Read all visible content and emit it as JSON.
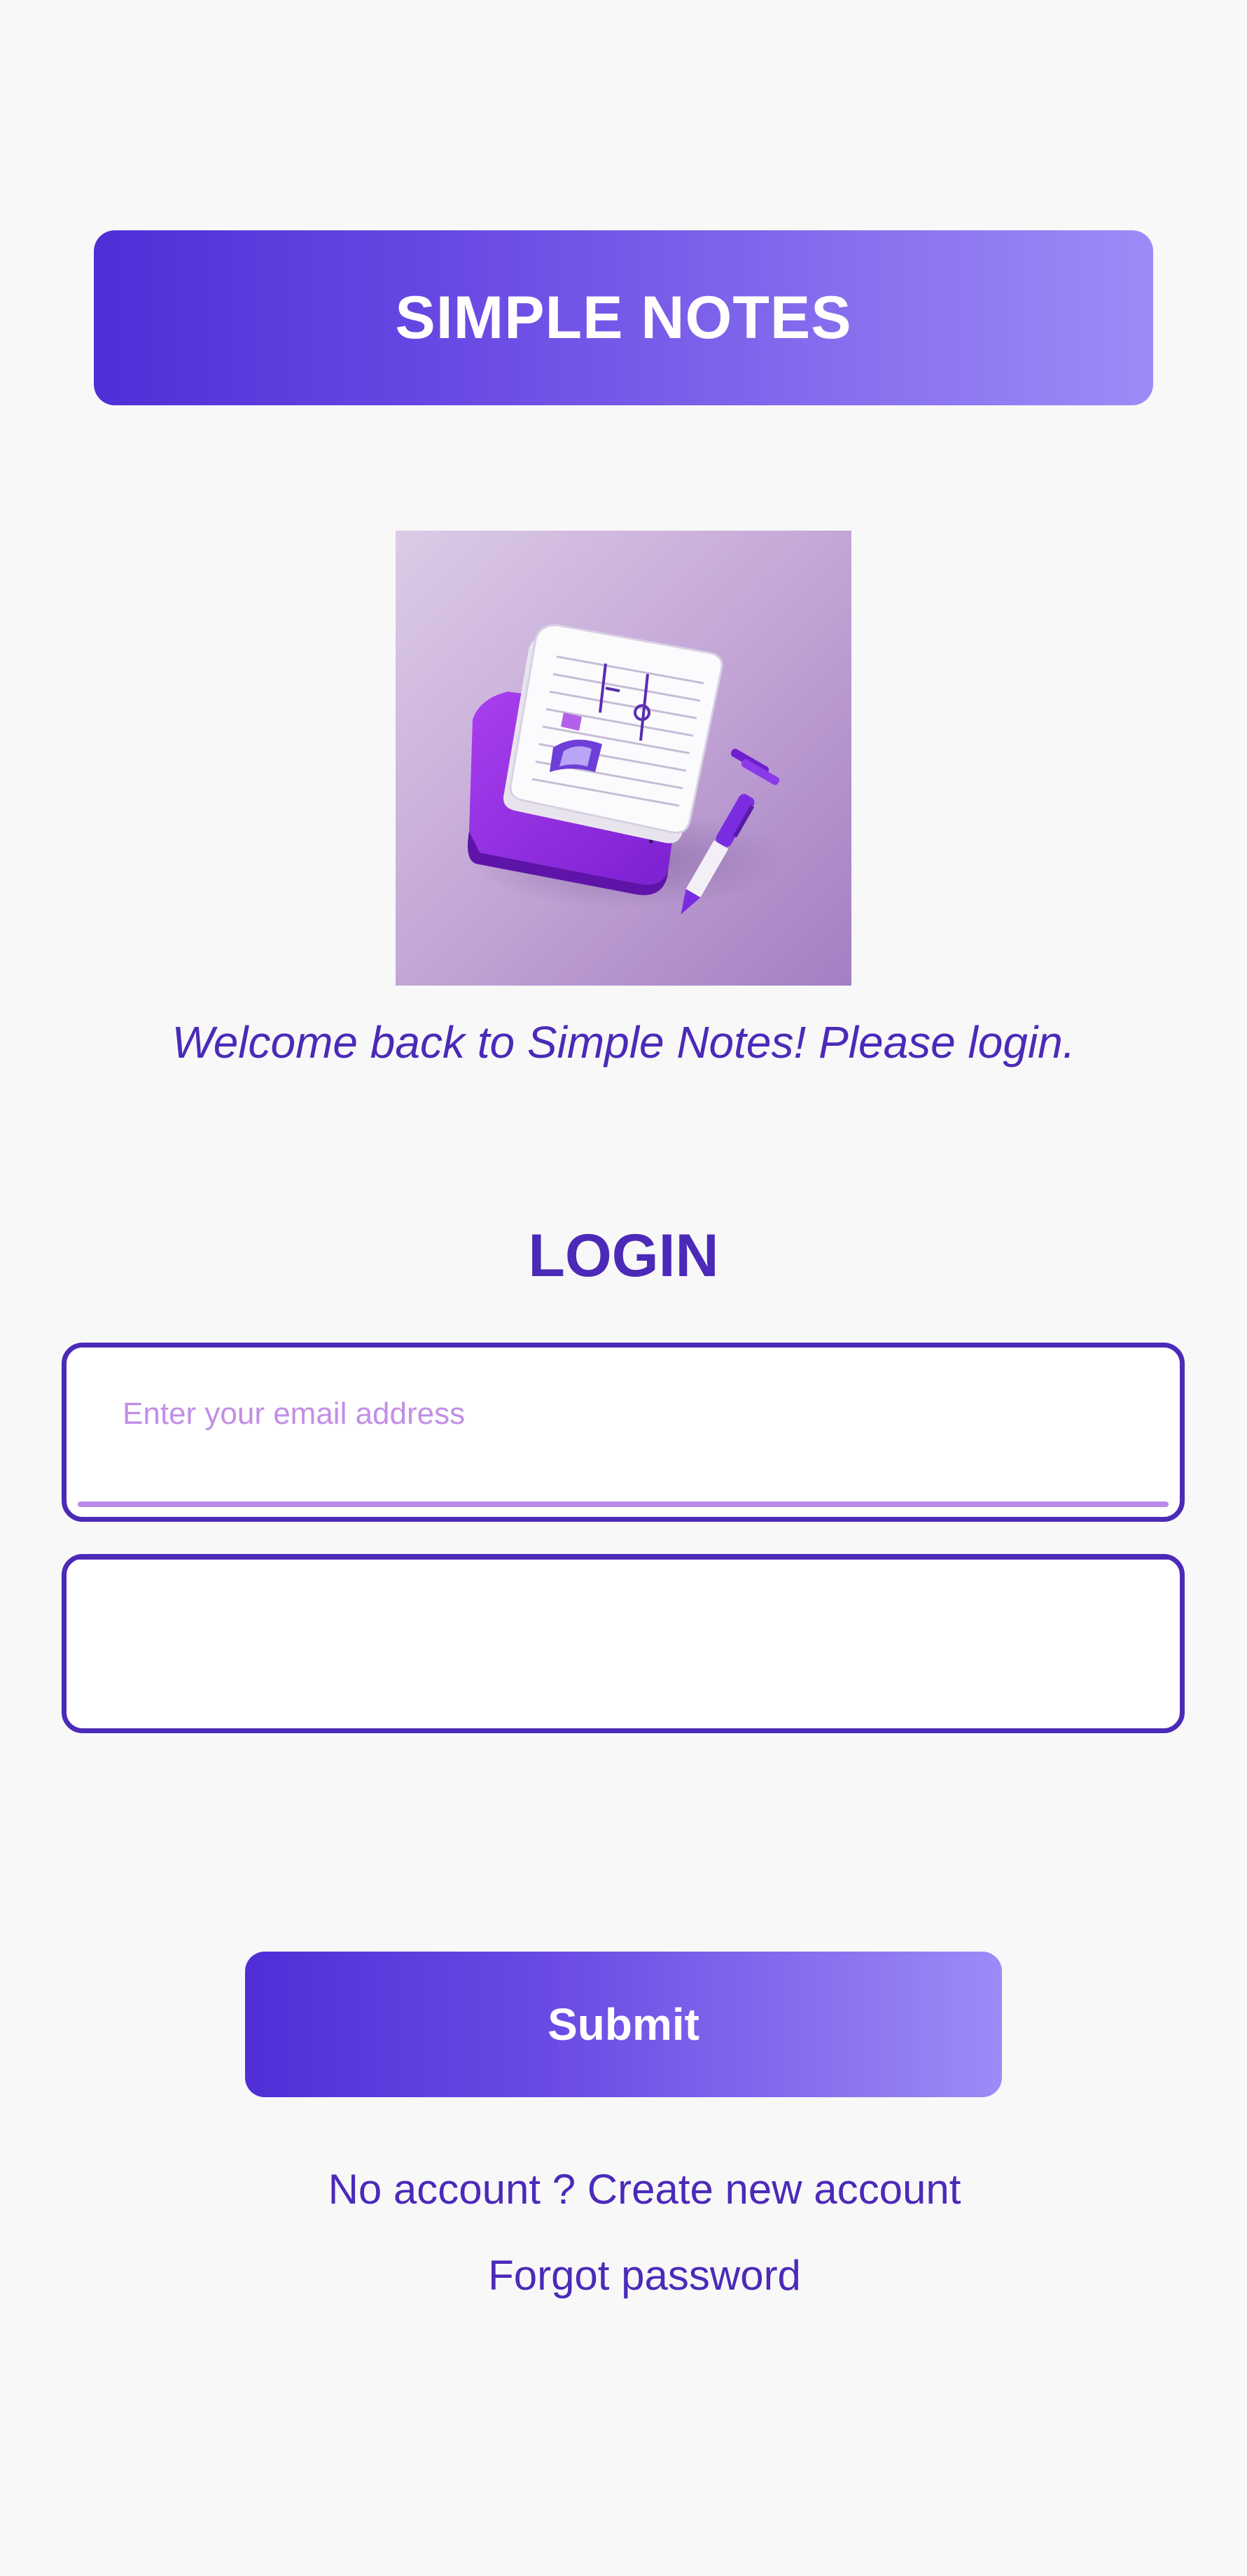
{
  "app": {
    "title": "SIMPLE NOTES"
  },
  "hero": {
    "icon": "notebook-with-pen-illustration"
  },
  "welcome_text": "Welcome back to Simple Notes! Please login.",
  "login": {
    "title": "LOGIN",
    "email": {
      "placeholder": "Enter your email address",
      "value": ""
    },
    "password": {
      "placeholder": "",
      "value": ""
    },
    "submit_label": "Submit"
  },
  "links": {
    "create_account": "No account ? Create new account",
    "forgot_password": "Forgot password"
  },
  "colors": {
    "primary": "#4b2ab8",
    "gradient_start": "#4f2fd6",
    "gradient_end": "#9d8bf8",
    "placeholder": "#c28ee6",
    "background": "#f8f8f9"
  }
}
